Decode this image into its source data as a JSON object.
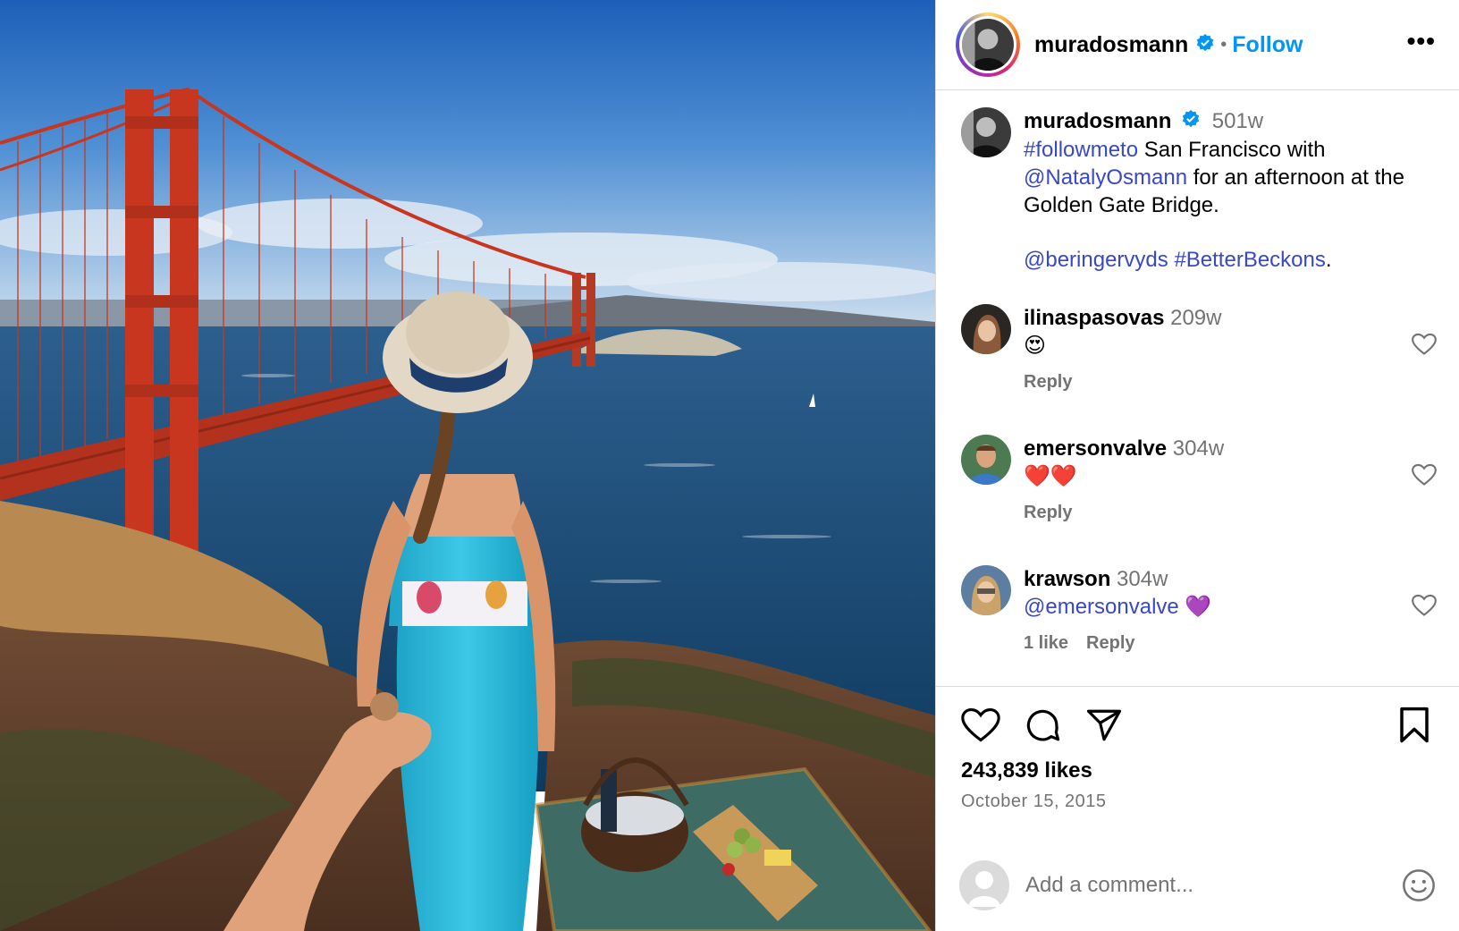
{
  "header": {
    "username": "muradosmann",
    "separator": "•",
    "follow_label": "Follow",
    "more_label": "•••"
  },
  "caption": {
    "username": "muradosmann",
    "time": "501w",
    "hashtag1": "#followmeto",
    "text1": " San Francisco with ",
    "mention1": "@NatalyOsmann",
    "text2": " for an afternoon at the Golden Gate Bridge.",
    "mention2": "@beringervyds",
    "hashtag2": "#BetterBeckons",
    "text3": "."
  },
  "comments": [
    {
      "username": "ilinaspasovas",
      "time": "209w",
      "text": "😍",
      "reply_label": "Reply"
    },
    {
      "username": "emersonvalve",
      "time": "304w",
      "text": "❤️❤️",
      "reply_label": "Reply"
    },
    {
      "username": "krawson",
      "time": "304w",
      "mention": "@emersonvalve",
      "text": " 💜",
      "likes_label": "1 like",
      "reply_label": "Reply"
    }
  ],
  "stats": {
    "likes": "243,839 likes",
    "date": "October 15, 2015"
  },
  "add_comment": {
    "placeholder": "Add a comment..."
  },
  "colors": {
    "accent": "#0095f6",
    "link": "#3848c6",
    "secondary_text": "#737373",
    "border": "#dbdbdb",
    "bridge_red": "#c8361f"
  }
}
